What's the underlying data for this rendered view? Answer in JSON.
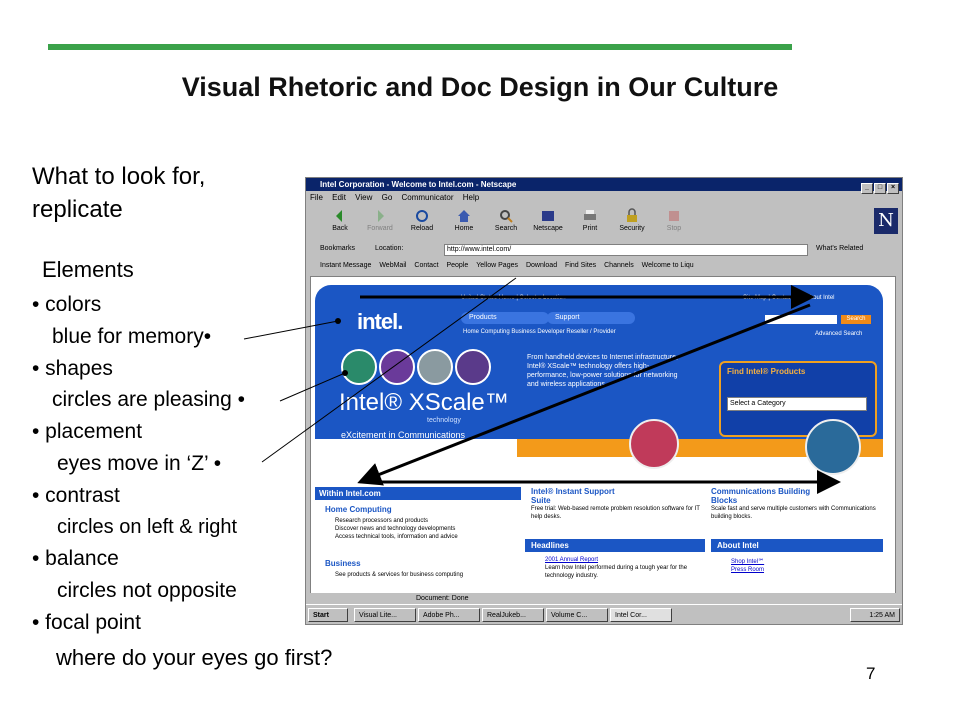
{
  "slide": {
    "title": "Visual Rhetoric and Doc Design in Our Culture",
    "intro_line1": "What to look for,",
    "intro_line2": "replicate",
    "elements_heading": "Elements",
    "bullets": [
      "• colors",
      "blue for memory•",
      "• shapes",
      "circles are pleasing •",
      "• placement",
      "eyes move in ‘Z’ •",
      "• contrast",
      "circles on left & right",
      "• balance",
      "circles not opposite",
      "• focal point"
    ],
    "last_line": "where do your eyes go first?",
    "page_number": "7",
    "accent_color": "#3ba24a"
  },
  "browser": {
    "title": "Intel Corporation - Welcome to Intel.com - Netscape",
    "menu": [
      "File",
      "Edit",
      "View",
      "Go",
      "Communicator",
      "Help"
    ],
    "nav_buttons": [
      "Back",
      "Forward",
      "Reload",
      "Home",
      "Search",
      "Netscape",
      "Print",
      "Security",
      "Stop"
    ],
    "bookmarks_label": "Bookmarks",
    "location_label": "Location:",
    "url": "http://www.intel.com/",
    "whats_related": "What's Related",
    "personal_links": [
      "Instant Message",
      "WebMail",
      "Contact",
      "People",
      "Yellow Pages",
      "Download",
      "Find Sites",
      "Channels",
      "Welcome to Liqu"
    ],
    "status": "Document: Done"
  },
  "intel_page": {
    "top_links": "United States  Home  |  Select a Location",
    "top_links_right": "Site Map  |  Contact Us  |  About Intel",
    "logo": "intel.",
    "tab_products": "Products",
    "tab_support": "Support",
    "subnav": "Home Computing   Business   Developer   Reseller / Provider",
    "search_button": "Search",
    "advanced_search": "Advanced Search",
    "hero_title": "Intel® XScale™",
    "hero_technology": "technology",
    "hero_tagline": "eXcitement in Communications",
    "hero_text": "From handheld devices to Internet infrastructure, Intel® XScale™ technology offers high-performance, low-power solutions for networking and wireless applications.",
    "find_products": "Find Intel® Products",
    "select_category": "Select a Category",
    "within": "Within Intel.com",
    "home_computing": "Home Computing",
    "home_items": [
      "Research processors and products",
      "Discover news and technology developments",
      "Access technical tools, information and advice"
    ],
    "business": "Business",
    "business_item": "See products & services for business computing",
    "instant_support_title": "Intel® Instant Support Suite",
    "instant_support_text": "Free trial: Web-based remote problem resolution software for IT help desks.",
    "comm_title": "Communications Building Blocks",
    "comm_text": "Scale fast and serve multiple customers with Communications building blocks.",
    "headlines": "Headlines",
    "headline_title": "2001 Annual Report",
    "headline_text": "Learn how Intel performed during a tough year for the technology industry.",
    "about_intel": "About Intel",
    "about_items": [
      "Shop Intel℠",
      "Press Room"
    ]
  },
  "taskbar": {
    "start": "Start",
    "tasks": [
      "Visual Lite...",
      "Adobe Ph...",
      "RealJukeb...",
      "Volume C...",
      "Intel Cor..."
    ],
    "clock": "1:25 AM"
  }
}
